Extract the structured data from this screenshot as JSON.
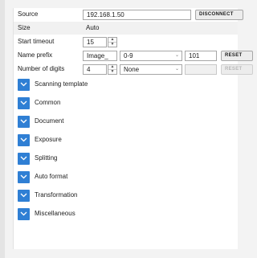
{
  "settings": {
    "source": {
      "label": "Source",
      "value": "192.168.1.50",
      "button": "DISCONNECT"
    },
    "size": {
      "label": "Size",
      "value": "Auto"
    },
    "start_timeout": {
      "label": "Start timeout",
      "value": "15"
    },
    "name_prefix": {
      "label": "Name prefix",
      "value": "Image_",
      "charset": "0-9",
      "start_number": "101",
      "button": "RESET"
    },
    "number_of_digits": {
      "label": "Number of digits",
      "value": "4",
      "padding": "None",
      "button": "RESET"
    }
  },
  "sections": [
    {
      "label": "Scanning template"
    },
    {
      "label": "Common"
    },
    {
      "label": "Document"
    },
    {
      "label": "Exposure"
    },
    {
      "label": "Splitting"
    },
    {
      "label": "Auto format"
    },
    {
      "label": "Transformation"
    },
    {
      "label": "Miscellaneous"
    }
  ],
  "colors": {
    "accent": "#2f7fd4"
  },
  "icons": {
    "section_toggle": "chevron-down-icon",
    "spinner": "spinner-arrows-icon"
  }
}
